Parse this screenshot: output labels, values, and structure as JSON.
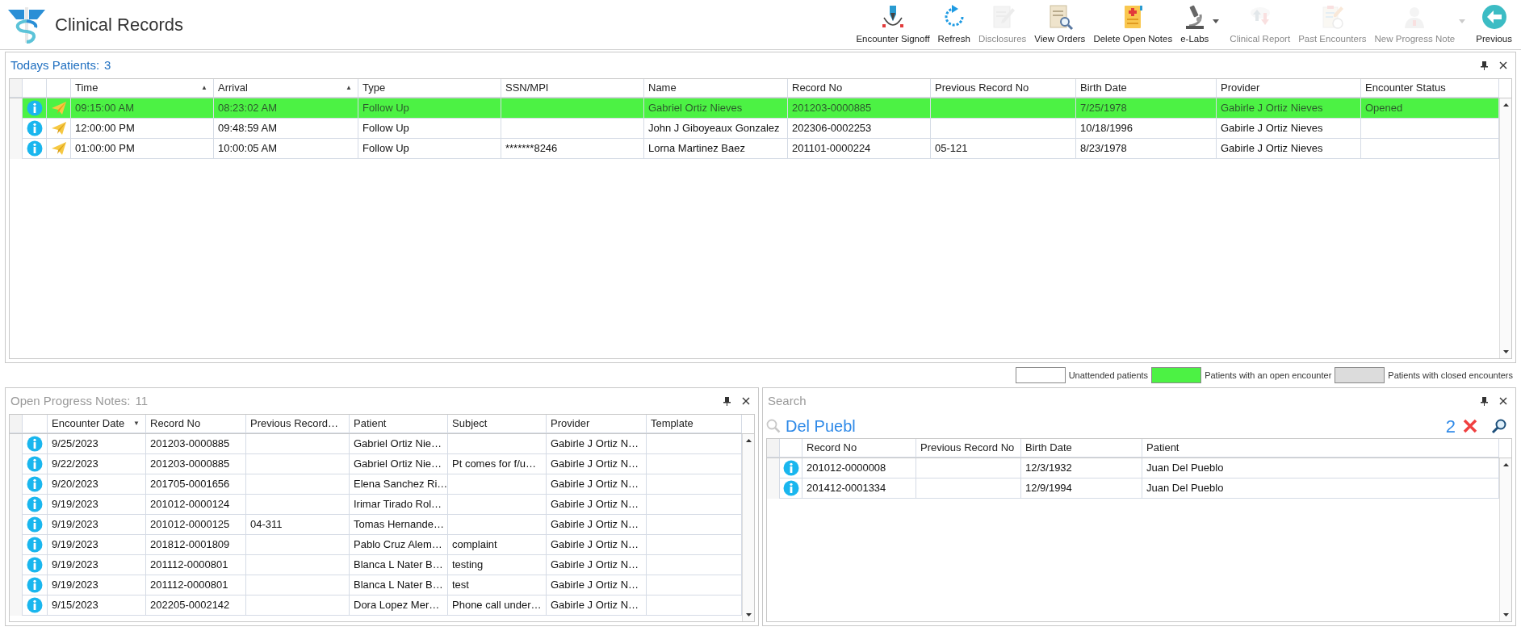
{
  "app": {
    "title": "Clinical Records"
  },
  "toolbar": [
    {
      "kind": "signoff",
      "label": "Encounter Signoff",
      "disabled": false,
      "dropdown": false
    },
    {
      "kind": "refresh",
      "label": "Refresh",
      "disabled": false,
      "dropdown": false
    },
    {
      "kind": "disclosures",
      "label": "Disclosures",
      "disabled": true,
      "dropdown": false
    },
    {
      "kind": "orders",
      "label": "View Orders",
      "disabled": false,
      "dropdown": false
    },
    {
      "kind": "delete_notes",
      "label": "Delete Open Notes",
      "disabled": false,
      "dropdown": false
    },
    {
      "kind": "labs",
      "label": "e-Labs",
      "disabled": false,
      "dropdown": true
    },
    {
      "kind": "clinical_report",
      "label": "Clinical Report",
      "disabled": true,
      "dropdown": false
    },
    {
      "kind": "past_encounters",
      "label": "Past Encounters",
      "disabled": true,
      "dropdown": false
    },
    {
      "kind": "new_note",
      "label": "New Progress Note",
      "disabled": true,
      "dropdown": true
    },
    {
      "kind": "previous",
      "label": "Previous",
      "disabled": false,
      "dropdown": false
    }
  ],
  "todays_patients": {
    "title": "Todays Patients:",
    "count": "3",
    "active": true,
    "columns": [
      {
        "label": "Time",
        "sort_mark": "▲"
      },
      {
        "label": "Arrival",
        "sort_mark": "▲"
      },
      {
        "label": "Type"
      },
      {
        "label": "SSN/MPI"
      },
      {
        "label": "Name"
      },
      {
        "label": "Record No"
      },
      {
        "label": "Previous Record No"
      },
      {
        "label": "Birth Date"
      },
      {
        "label": "Provider"
      },
      {
        "label": "Encounter Status"
      }
    ],
    "rows": [
      {
        "open_encounter": true,
        "time": "09:15:00 AM",
        "arrival": "08:23:02 AM",
        "type": "Follow Up",
        "name": "Gabriel Ortiz Nieves",
        "record_no": "201203-0000885",
        "birth_date": "7/25/1978",
        "provider": "Gabirle J Ortiz Nieves",
        "encounter_status": "Opened"
      },
      {
        "open_encounter": false,
        "time": "12:00:00 PM",
        "arrival": "09:48:59 AM",
        "type": "Follow Up",
        "name": "John J Giboyeaux Gonzalez",
        "record_no": "202306-0002253",
        "birth_date": "10/18/1996",
        "provider": "Gabirle J Ortiz Nieves"
      },
      {
        "open_encounter": false,
        "time": "01:00:00 PM",
        "arrival": "10:00:05 AM",
        "type": "Follow Up",
        "ssn_mpi": "*******8246",
        "name": "Lorna Martinez Baez",
        "record_no": "201101-0000224",
        "previous_record_no": "05-121",
        "birth_date": "8/23/1978",
        "provider": "Gabirle J Ortiz Nieves"
      }
    ]
  },
  "legend": [
    {
      "label": "Unattended patients",
      "color": "#ffffff"
    },
    {
      "label": "Patients with an open encounter",
      "color": "#4cf244"
    },
    {
      "label": "Patients with closed encounters",
      "color": "#dcdcdc"
    }
  ],
  "open_progress_notes": {
    "title": "Open Progress Notes:",
    "count": "11",
    "active": false,
    "columns": [
      {
        "label": "Encounter Date",
        "sort_mark": "▼"
      },
      {
        "label": "Record No"
      },
      {
        "label": "Previous Record…"
      },
      {
        "label": "Patient"
      },
      {
        "label": "Subject"
      },
      {
        "label": "Provider"
      },
      {
        "label": "Template"
      }
    ],
    "rows": [
      {
        "encounter_date": "9/25/2023",
        "record_no": "201203-0000885",
        "patient": "Gabriel Ortiz Nie…",
        "provider": "Gabirle J Ortiz N…"
      },
      {
        "encounter_date": "9/22/2023",
        "record_no": "201203-0000885",
        "patient": "Gabriel Ortiz Nie…",
        "subject": "Pt comes for f/u…",
        "provider": "Gabirle J Ortiz N…"
      },
      {
        "encounter_date": "9/20/2023",
        "record_no": "201705-0001656",
        "patient": "Elena Sanchez Ri…",
        "provider": "Gabirle J Ortiz N…"
      },
      {
        "encounter_date": "9/19/2023",
        "record_no": "201012-0000124",
        "patient": "Irimar Tirado Rol…",
        "provider": "Gabirle J Ortiz N…"
      },
      {
        "encounter_date": "9/19/2023",
        "record_no": "201012-0000125",
        "previous_record_no": "04-311",
        "patient": "Tomas Hernande…",
        "provider": "Gabirle J Ortiz N…"
      },
      {
        "encounter_date": "9/19/2023",
        "record_no": "201812-0001809",
        "patient": "Pablo Cruz Alem…",
        "subject": "complaint",
        "provider": "Gabirle J Ortiz N…"
      },
      {
        "encounter_date": "9/19/2023",
        "record_no": "201112-0000801",
        "patient": "Blanca L Nater B…",
        "subject": "testing",
        "provider": "Gabirle J Ortiz N…"
      },
      {
        "encounter_date": "9/19/2023",
        "record_no": "201112-0000801",
        "patient": "Blanca L Nater B…",
        "subject": "test",
        "provider": "Gabirle J Ortiz N…"
      },
      {
        "encounter_date": "9/15/2023",
        "record_no": "202205-0002142",
        "patient": "Dora Lopez Mer…",
        "subject": "Phone call under…",
        "provider": "Gabirle J Ortiz N…"
      }
    ]
  },
  "search": {
    "title": "Search",
    "active": false,
    "value": "Del Puebl",
    "result_count": "2",
    "columns": [
      {
        "label": "Record No"
      },
      {
        "label": "Previous Record No"
      },
      {
        "label": "Birth Date"
      },
      {
        "label": "Patient"
      }
    ],
    "rows": [
      {
        "record_no": "201012-0000008",
        "birth_date": "12/3/1932",
        "patient": "Juan Del Pueblo"
      },
      {
        "record_no": "201412-0001334",
        "birth_date": "12/9/1994",
        "patient": "Juan Del Pueblo"
      }
    ]
  }
}
